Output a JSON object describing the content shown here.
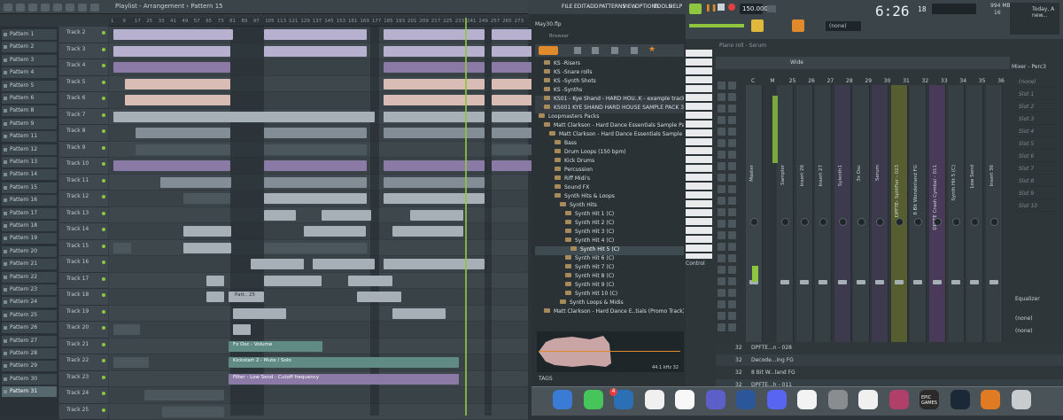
{
  "playlist": {
    "title": "Playlist - Arrangement",
    "pattern_selector": "Pattern 15",
    "ruler_ticks": [
      "1",
      "9",
      "17",
      "25",
      "33",
      "41",
      "49",
      "57",
      "65",
      "73",
      "81",
      "89",
      "97",
      "105",
      "113",
      "121",
      "129",
      "137",
      "145",
      "153",
      "161",
      "169",
      "177",
      "185",
      "193",
      "201",
      "209",
      "217",
      "225",
      "233",
      "241",
      "249",
      "257",
      "265",
      "273"
    ],
    "patterns": [
      "Pattern 1",
      "Pattern 2",
      "Pattern 3",
      "Pattern 4",
      "Pattern 5",
      "Pattern 6",
      "Pattern 8",
      "Pattern 9",
      "Pattern 11",
      "Pattern 12",
      "Pattern 13",
      "Pattern 14",
      "Pattern 15",
      "Pattern 16",
      "Pattern 17",
      "Pattern 18",
      "Pattern 19",
      "Pattern 20",
      "Pattern 21",
      "Pattern 22",
      "Pattern 23",
      "Pattern 24",
      "Pattern 25",
      "Pattern 26",
      "Pattern 27",
      "Pattern 28",
      "Pattern 29",
      "Pattern 30",
      "Pattern 31"
    ],
    "tracks": [
      "Track 2",
      "Track 3",
      "Track 4",
      "Track 5",
      "Track 6",
      "Track 7",
      "Track 8",
      "Track 9",
      "Track 10",
      "Track 11",
      "Track 12",
      "Track 13",
      "Track 14",
      "Track 15",
      "Track 16",
      "Track 17",
      "Track 18",
      "Track 19",
      "Track 20",
      "Track 21",
      "Track 22",
      "Track 23",
      "Track 24",
      "Track 25"
    ],
    "automation_labels": [
      "Fx Osc - Volume",
      "Kickstart 2 - Mute / Solo",
      "Filter - Low Send - Cutoff frequency"
    ],
    "clip_label": "Patt.. 25"
  },
  "menu": {
    "file": "FILE",
    "edit": "EDIT",
    "add": "ADD",
    "patterns": "PATTERNS",
    "view": "VIEW",
    "options": "OPTIONS",
    "tools": "TOOLS",
    "help": "HELP",
    "project": "May30.flp",
    "browser": "Browser"
  },
  "transport": {
    "tempo": "150.000",
    "time": "6:26",
    "time_small": "18",
    "memory": "994 MB",
    "memory2": "16",
    "pattern_select": "(none)",
    "hint": "Today, A new..."
  },
  "browser": {
    "items": [
      {
        "label": "KS -Risers",
        "depth": 1
      },
      {
        "label": "KS -Snare rolls",
        "depth": 1
      },
      {
        "label": "KS -Synth Shots",
        "depth": 1
      },
      {
        "label": "KS -Synths",
        "depth": 1
      },
      {
        "label": "KS01 - Kye Shand - HARD HOU..K - example track (master)",
        "depth": 1
      },
      {
        "label": "KS001 KYE SHAND HARD HOUSE SAMPLE PACK 3",
        "depth": 1
      },
      {
        "label": "Loopmasters Packs",
        "depth": 0
      },
      {
        "label": "Matt Clarkson - Hard Dance Essentials Sample Pack",
        "depth": 1
      },
      {
        "label": "Matt Clarkson - Hard Dance Essentials Sample Pack",
        "depth": 2
      },
      {
        "label": "Bass",
        "depth": 3
      },
      {
        "label": "Drum Loops (150 bpm)",
        "depth": 3
      },
      {
        "label": "Kick Drums",
        "depth": 3
      },
      {
        "label": "Percussion",
        "depth": 3
      },
      {
        "label": "Riff Midi's",
        "depth": 3
      },
      {
        "label": "Sound FX",
        "depth": 3
      },
      {
        "label": "Synth Hits & Loops",
        "depth": 3
      },
      {
        "label": "Synth Hits",
        "depth": 4
      },
      {
        "label": "Synth Hit 1 (C)",
        "depth": 5
      },
      {
        "label": "Synth Hit 2 (C)",
        "depth": 5
      },
      {
        "label": "Synth Hit 3 (C)",
        "depth": 5
      },
      {
        "label": "Synth Hit 4 (C)",
        "depth": 5
      },
      {
        "label": "Synth Hit 5 (C)",
        "depth": 6
      },
      {
        "label": "Synth Hit 6 (C)",
        "depth": 5
      },
      {
        "label": "Synth Hit 7 (C)",
        "depth": 5
      },
      {
        "label": "Synth Hit 8 (C)",
        "depth": 5
      },
      {
        "label": "Synth Hit 9 (C)",
        "depth": 5
      },
      {
        "label": "Synth Hit 10 (C)",
        "depth": 5
      },
      {
        "label": "Synth Loops & Midis",
        "depth": 4
      },
      {
        "label": "Matt Clarkson - Hard Dance E..tials (Promo Track) (Master)",
        "depth": 1
      }
    ],
    "waveform_info": "44.1 kHz 32",
    "tags": "TAGS"
  },
  "mixer": {
    "piano_roll_title": "Piano roll - Serum",
    "wide": "Wide",
    "mixer_title": "Mixer - Perc3",
    "channel_numbers": [
      "C",
      "M",
      "25",
      "26",
      "27",
      "28",
      "29",
      "30",
      "31",
      "32",
      "33",
      "34",
      "35",
      "36"
    ],
    "channels": [
      "Master",
      "Sampler",
      "Insert 26",
      "Insert 27",
      "Sylenth1",
      "3x Osc",
      "Serum",
      "DPFTE- SplitFier - 023",
      "8 Bit Wonderland FG",
      "DPFTE Crash Cymbal - 011",
      "Synth Hit 5 (C)",
      "Low Send",
      "Insert 36"
    ],
    "slots": [
      "(none)",
      "Slot 1",
      "Slot 2",
      "Slot 3",
      "Slot 4",
      "Slot 5",
      "Slot 6",
      "Slot 7",
      "Slot 8",
      "Slot 9",
      "Slot 10"
    ],
    "eq": "Equalizer",
    "none1": "(none)",
    "none2": "(none)",
    "control": "Control",
    "bottom_rows": [
      {
        "num": "32",
        "label": "DPFTE...n - 028"
      },
      {
        "num": "32",
        "label": "Decode...ing FG"
      },
      {
        "num": "32",
        "label": "8 Bit W...land FG"
      },
      {
        "num": "32",
        "label": "DPFTE...h - 011"
      }
    ]
  },
  "dock": {
    "badge": "4",
    "apps": [
      "finder-icon",
      "messages-icon",
      "vscode-icon",
      "photos-icon",
      "calendar-icon",
      "teams-icon",
      "word-icon",
      "discord-icon",
      "chrome-icon",
      "settings-icon",
      "capcut-icon",
      "ohm-icon",
      "epic-games-icon",
      "steam-icon",
      "fl-studio-icon",
      "trash-icon"
    ],
    "epic_label": "EPIC GAMES"
  }
}
